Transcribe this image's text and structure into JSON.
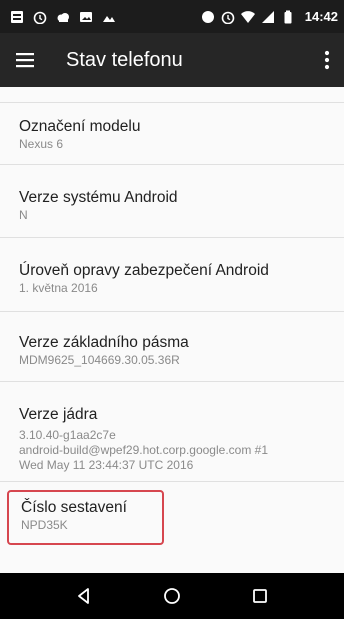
{
  "status_bar": {
    "left_icons": [
      "notification-square-icon",
      "alarm-icon",
      "cloud-icon",
      "image-icon",
      "mountain-icon"
    ],
    "right_icons": [
      "record-icon",
      "alarm-icon",
      "wifi-icon",
      "signal-icon",
      "battery-icon"
    ],
    "time": "14:42"
  },
  "app_bar": {
    "title": "Stav telefonu",
    "menu_icon": "hamburger-menu-icon",
    "overflow_icon": "more-vert-icon"
  },
  "items": [
    {
      "title": "Označení modelu",
      "subtitle": "Nexus 6"
    },
    {
      "title": "Verze systému Android",
      "subtitle": "N"
    },
    {
      "title": "Úroveň opravy zabezpečení Android",
      "subtitle": "1. května 2016"
    },
    {
      "title": "Verze základního pásma",
      "subtitle": "MDM9625_104669.30.05.36R"
    },
    {
      "title": "Verze jádra",
      "subtitle_lines": [
        "3.10.40-g1aa2c7e",
        "android-build@wpef29.hot.corp.google.com #1",
        "Wed May 11 23:44:37 UTC 2016"
      ]
    },
    {
      "title": "Číslo sestavení",
      "subtitle": "NPD35K"
    }
  ],
  "highlight_color": "#d6464f",
  "nav_bar": {
    "buttons": [
      "back-icon",
      "home-icon",
      "recents-icon"
    ]
  }
}
